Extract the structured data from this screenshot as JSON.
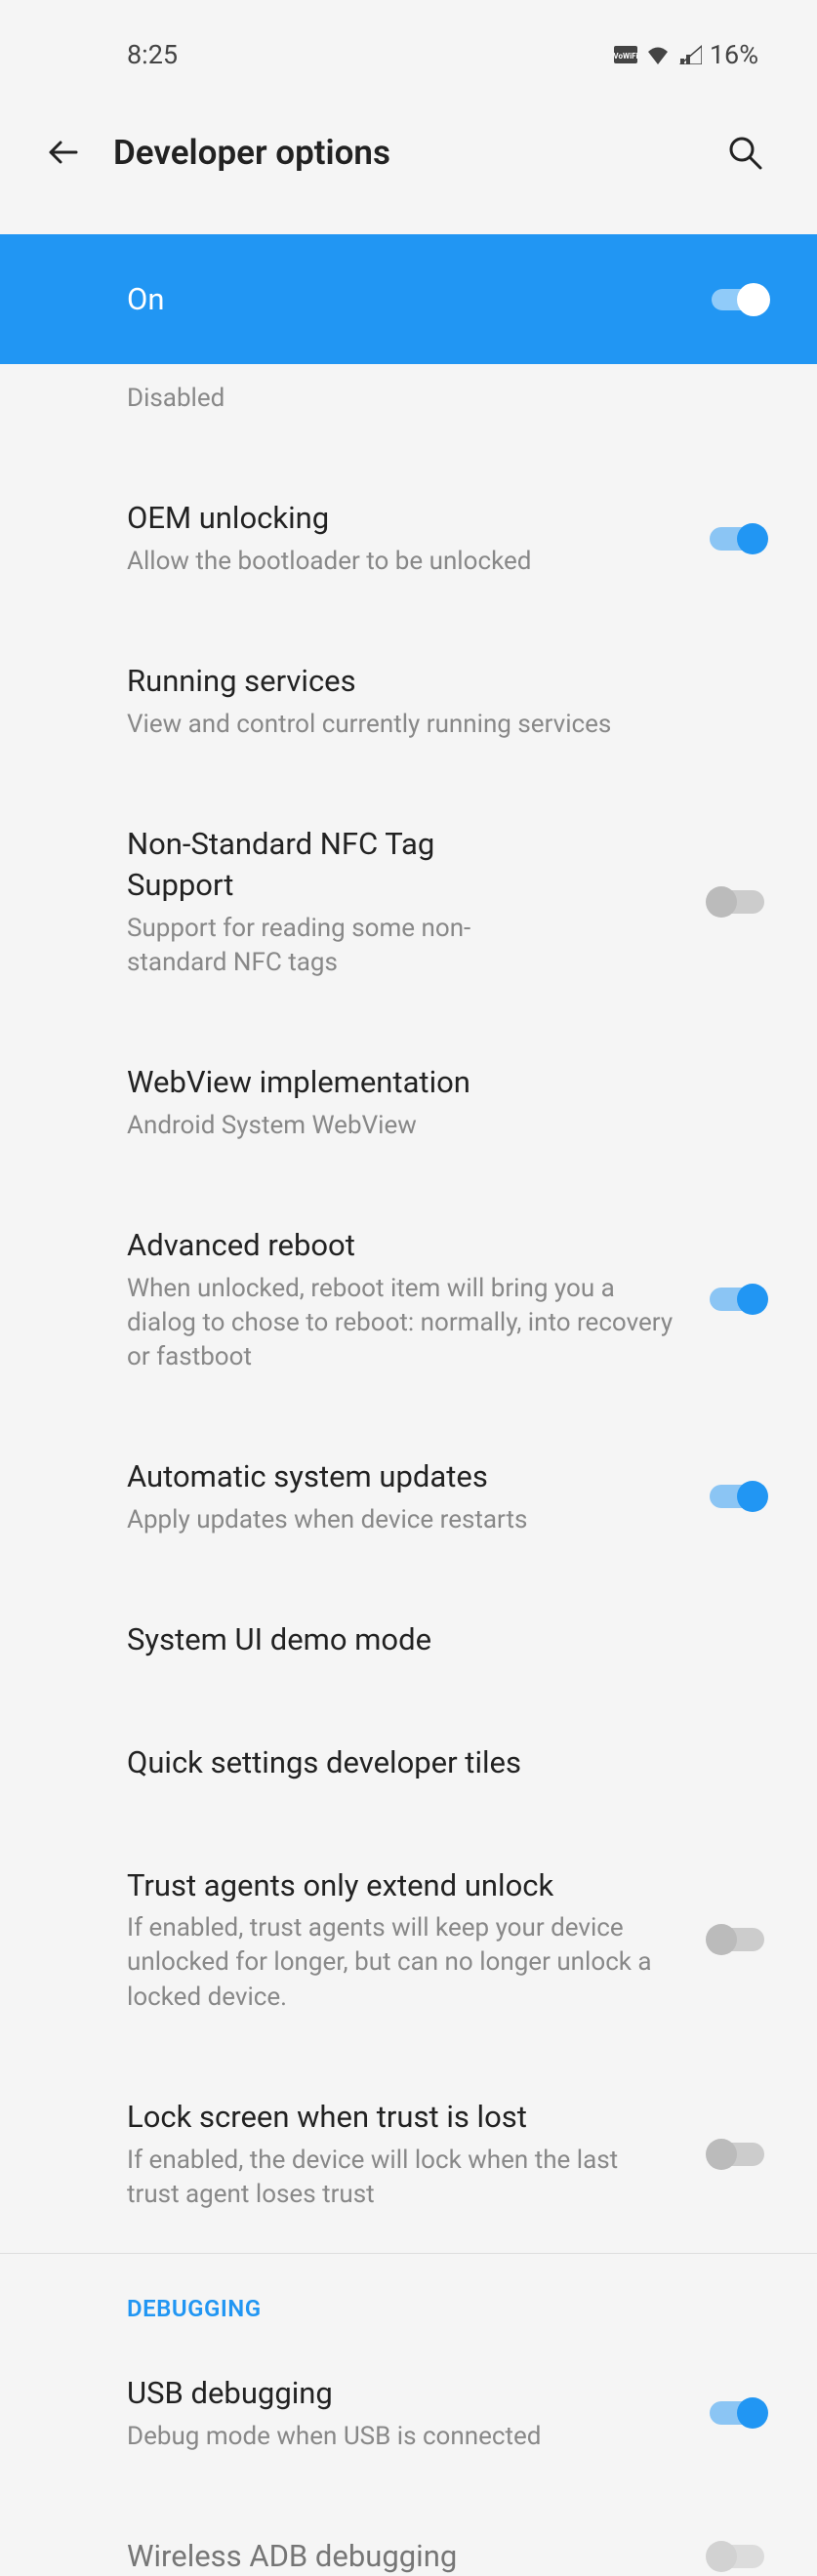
{
  "status_bar": {
    "time": "8:25",
    "battery": "16%"
  },
  "header": {
    "title": "Developer options"
  },
  "master_toggle": {
    "label": "On",
    "enabled": true
  },
  "settings": {
    "partial_disabled": {
      "subtitle": "Disabled"
    },
    "oem_unlocking": {
      "title": "OEM unlocking",
      "subtitle": "Allow the bootloader to be unlocked",
      "enabled": true
    },
    "running_services": {
      "title": "Running services",
      "subtitle": "View and control currently running services"
    },
    "nfc_tag": {
      "title": "Non-Standard NFC Tag Support",
      "subtitle": "Support for reading some non-standard NFC tags",
      "enabled": false
    },
    "webview": {
      "title": "WebView implementation",
      "subtitle": "Android System WebView"
    },
    "advanced_reboot": {
      "title": "Advanced reboot",
      "subtitle": "When unlocked, reboot item will bring you a dialog to chose to reboot: normally, into recovery or fastboot",
      "enabled": true
    },
    "auto_updates": {
      "title": "Automatic system updates",
      "subtitle": "Apply updates when device restarts",
      "enabled": true
    },
    "demo_mode": {
      "title": "System UI demo mode"
    },
    "quick_settings": {
      "title": "Quick settings developer tiles"
    },
    "trust_agents": {
      "title": "Trust agents only extend unlock",
      "subtitle": "If enabled, trust agents will keep your device unlocked for longer, but can no longer unlock a locked device.",
      "enabled": false
    },
    "lock_screen_trust": {
      "title": "Lock screen when trust is lost",
      "subtitle": "If enabled, the device will lock when the last trust agent loses trust",
      "enabled": false
    }
  },
  "sections": {
    "debugging": "DEBUGGING"
  },
  "debugging": {
    "usb_debugging": {
      "title": "USB debugging",
      "subtitle": "Debug mode when USB is connected",
      "enabled": true
    },
    "wireless_adb": {
      "title": "Wireless ADB debugging",
      "enabled": false
    }
  }
}
